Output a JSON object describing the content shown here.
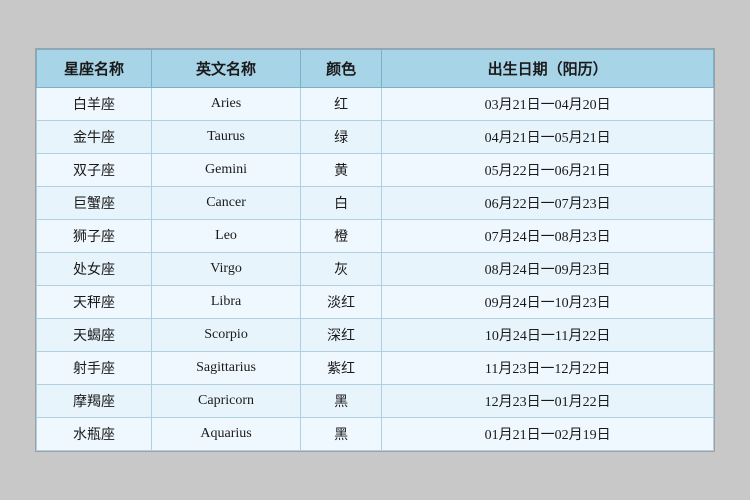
{
  "table": {
    "headers": [
      "星座名称",
      "英文名称",
      "颜色",
      "出生日期（阳历）"
    ],
    "rows": [
      {
        "zh": "白羊座",
        "en": "Aries",
        "color": "红",
        "date": "03月21日一04月20日"
      },
      {
        "zh": "金牛座",
        "en": "Taurus",
        "color": "绿",
        "date": "04月21日一05月21日"
      },
      {
        "zh": "双子座",
        "en": "Gemini",
        "color": "黄",
        "date": "05月22日一06月21日"
      },
      {
        "zh": "巨蟹座",
        "en": "Cancer",
        "color": "白",
        "date": "06月22日一07月23日"
      },
      {
        "zh": "狮子座",
        "en": "Leo",
        "color": "橙",
        "date": "07月24日一08月23日"
      },
      {
        "zh": "处女座",
        "en": "Virgo",
        "color": "灰",
        "date": "08月24日一09月23日"
      },
      {
        "zh": "天秤座",
        "en": "Libra",
        "color": "淡红",
        "date": "09月24日一10月23日"
      },
      {
        "zh": "天蝎座",
        "en": "Scorpio",
        "color": "深红",
        "date": "10月24日一11月22日"
      },
      {
        "zh": "射手座",
        "en": "Sagittarius",
        "color": "紫红",
        "date": "11月23日一12月22日"
      },
      {
        "zh": "摩羯座",
        "en": "Capricorn",
        "color": "黑",
        "date": "12月23日一01月22日"
      },
      {
        "zh": "水瓶座",
        "en": "Aquarius",
        "color": "黑",
        "date": "01月21日一02月19日"
      }
    ]
  }
}
